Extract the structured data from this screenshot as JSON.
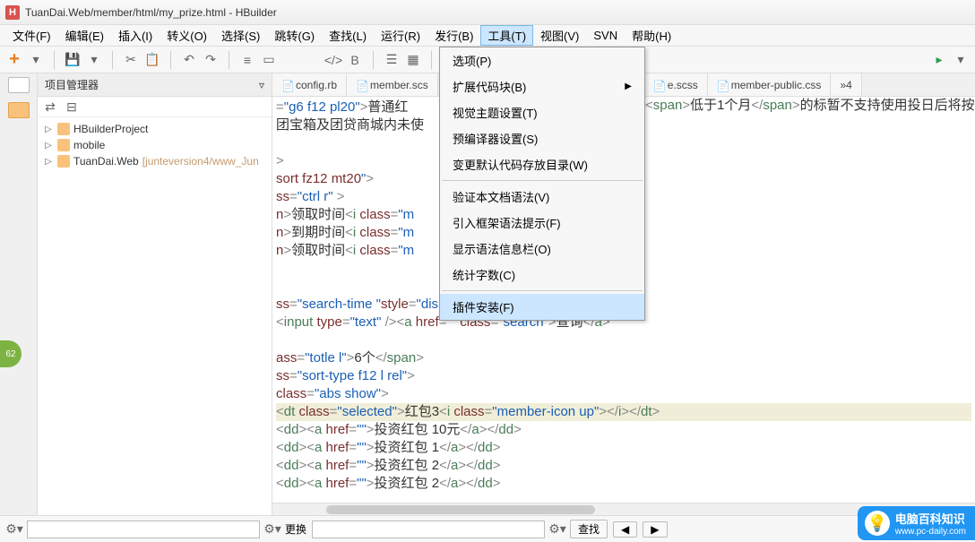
{
  "title": "TuanDai.Web/member/html/my_prize.html  -  HBuilder",
  "title_icon_text": "H",
  "menus": [
    "文件(F)",
    "编辑(E)",
    "插入(I)",
    "转义(O)",
    "选择(S)",
    "跳转(G)",
    "查找(L)",
    "运行(R)",
    "发行(B)",
    "工具(T)",
    "视图(V)",
    "SVN",
    "帮助(H)"
  ],
  "active_menu_index": 9,
  "dropdown": {
    "items": [
      {
        "label": "选项(P)",
        "sub": false
      },
      {
        "label": "扩展代码块(B)",
        "sub": true
      },
      {
        "label": "视觉主题设置(T)",
        "sub": false
      },
      {
        "label": "预编译器设置(S)",
        "sub": false
      },
      {
        "label": "变更默认代码存放目录(W)",
        "sub": false
      }
    ],
    "items2": [
      {
        "label": "验证本文档语法(V)"
      },
      {
        "label": "引入框架语法提示(F)"
      },
      {
        "label": "显示语法信息栏(O)"
      },
      {
        "label": "统计字数(C)"
      }
    ],
    "items3": [
      {
        "label": "插件安装(F)"
      }
    ]
  },
  "panel": {
    "title": "项目管理器",
    "tree": [
      {
        "label": "HBuilderProject",
        "icon": "folder"
      },
      {
        "label": "mobile",
        "icon": "folder"
      },
      {
        "label": "TuanDai.Web",
        "branch": "[junteversion4/www_Jun",
        "icon": "folder"
      }
    ]
  },
  "tabs": [
    "config.rb",
    "member.scs",
    "e.scss",
    "member-public.css"
  ],
  "tabs_extra": "»4",
  "code_lines": [
    {
      "html": "<span class='s-punc'>=</span><span class='s-val'>\"g6 f12 pl20\"</span><span class='s-punc'>&gt;</span><span class='s-txt'>普通红</span>"
    },
    {
      "html": "<span class='s-txt'>团宝箱及团贷商城内未使</span>"
    },
    {
      "html": ""
    },
    {
      "html": "<span class='s-punc'>&gt;</span>"
    },
    {
      "html": "<span class='s-attr'>sort fz12 mt20</span><span class='s-val'>\"</span><span class='s-punc'>&gt;</span>"
    },
    {
      "html": "<span class='s-attr'>ss</span><span class='s-punc'>=</span><span class='s-val'>\"ctrl r\"</span> <span class='s-punc'>&gt;</span>"
    },
    {
      "html": "<span class='s-attr'>n</span><span class='s-punc'>&gt;</span><span class='s-txt'>领取时间</span><span class='s-punc'>&lt;</span><span class='s-tag'>i</span> <span class='s-attr'>class</span><span class='s-punc'>=</span><span class='s-val'>\"m</span>"
    },
    {
      "html": "<span class='s-attr'>n</span><span class='s-punc'>&gt;</span><span class='s-txt'>到期时间</span><span class='s-punc'>&lt;</span><span class='s-tag'>i</span> <span class='s-attr'>class</span><span class='s-punc'>=</span><span class='s-val'>\"m</span>"
    },
    {
      "html": "<span class='s-attr'>n</span><span class='s-punc'>&gt;</span><span class='s-txt'>领取时间</span><span class='s-punc'>&lt;</span><span class='s-tag'>i</span> <span class='s-attr'>class</span><span class='s-punc'>=</span><span class='s-val'>\"m</span>"
    },
    {
      "html": ""
    },
    {
      "html": ""
    },
    {
      "html": "<span class='s-attr'>ss</span><span class='s-punc'>=</span><span class='s-val'>\"search-time \"</span><span class='s-attr'>style</span><span class='s-punc'>=</span><span class='s-val'>\"display:none ;\"</span><span class='s-punc'>&gt;</span>"
    },
    {
      "html": "<span class='s-punc'>&lt;</span><span class='s-tag'>input</span> <span class='s-attr'>type</span><span class='s-punc'>=</span><span class='s-val'>\"text\"</span> <span class='s-punc'>/&gt;&lt;</span><span class='s-tag'>a</span> <span class='s-attr'>href</span><span class='s-punc'>=</span><span class='s-val'>\"\"</span> <span class='s-attr'>class</span><span class='s-punc'>=</span><span class='s-val'>\"search\"</span><span class='s-punc'>&gt;</span><span class='s-txt'>查询</span><span class='s-punc'>&lt;/</span><span class='s-tag'>a</span><span class='s-punc'>&gt;</span>"
    },
    {
      "html": ""
    },
    {
      "html": "<span class='s-attr'>ass</span><span class='s-punc'>=</span><span class='s-val'>\"totle l\"</span><span class='s-punc'>&gt;</span><span class='s-txt'>6个</span><span class='s-punc'>&lt;/</span><span class='s-tag'>span</span><span class='s-punc'>&gt;</span>"
    },
    {
      "html": "<span class='s-attr'>ss</span><span class='s-punc'>=</span><span class='s-val'>\"sort-type f12 l rel\"</span><span class='s-punc'>&gt;</span>"
    },
    {
      "html": "<span class='s-attr'>class</span><span class='s-punc'>=</span><span class='s-val'>\"abs show\"</span><span class='s-punc'>&gt;</span>"
    },
    {
      "html": "<span class='s-punc'>&lt;</span><span class='s-tag'>dt</span> <span class='s-attr'>class</span><span class='s-punc'>=</span><span class='s-val'>\"selected\"</span><span class='s-punc'>&gt;</span><span class='s-txt'>红包3</span><span class='s-punc'>&lt;</span><span class='s-tag'>i</span> <span class='s-attr'>class</span><span class='s-punc'>=</span><span class='s-val'>\"member-icon up\"</span><span class='s-punc'>&gt;&lt;/</span><span class='s-tag'>i</span><span class='s-punc'>&gt;&lt;/</span><span class='s-tag'>dt</span><span class='s-punc'>&gt;</span>",
      "hl": true
    },
    {
      "html": "<span class='s-punc'>&lt;</span><span class='s-tag'>dd</span><span class='s-punc'>&gt;&lt;</span><span class='s-tag'>a</span> <span class='s-attr'>href</span><span class='s-punc'>=</span><span class='s-val'>\"\"</span><span class='s-punc'>&gt;</span><span class='s-txt'>投资红包 10元</span><span class='s-punc'>&lt;/</span><span class='s-tag'>a</span><span class='s-punc'>&gt;&lt;/</span><span class='s-tag'>dd</span><span class='s-punc'>&gt;</span>"
    },
    {
      "html": "<span class='s-punc'>&lt;</span><span class='s-tag'>dd</span><span class='s-punc'>&gt;&lt;</span><span class='s-tag'>a</span> <span class='s-attr'>href</span><span class='s-punc'>=</span><span class='s-val'>\"\"</span><span class='s-punc'>&gt;</span><span class='s-txt'>投资红包 1</span><span class='s-punc'>&lt;/</span><span class='s-tag'>a</span><span class='s-punc'>&gt;&lt;/</span><span class='s-tag'>dd</span><span class='s-punc'>&gt;</span>"
    },
    {
      "html": "<span class='s-punc'>&lt;</span><span class='s-tag'>dd</span><span class='s-punc'>&gt;&lt;</span><span class='s-tag'>a</span> <span class='s-attr'>href</span><span class='s-punc'>=</span><span class='s-val'>\"\"</span><span class='s-punc'>&gt;</span><span class='s-txt'>投资红包 2</span><span class='s-punc'>&lt;/</span><span class='s-tag'>a</span><span class='s-punc'>&gt;&lt;/</span><span class='s-tag'>dd</span><span class='s-punc'>&gt;</span>"
    },
    {
      "html": "<span class='s-punc'>&lt;</span><span class='s-tag'>dd</span><span class='s-punc'>&gt;&lt;</span><span class='s-tag'>a</span> <span class='s-attr'>href</span><span class='s-punc'>=</span><span class='s-val'>\"\"</span><span class='s-punc'>&gt;</span><span class='s-txt'>投资红包 2</span><span class='s-punc'>&lt;/</span><span class='s-tag'>a</span><span class='s-punc'>&gt;&lt;/</span><span class='s-tag'>dd</span><span class='s-punc'>&gt;</span>"
    }
  ],
  "code_right": [
    {
      "html": "<span class='s-punc'>&lt;</span><span class='s-tag'>span</span><span class='s-punc'>&gt;</span><span class='s-txt'>低于1个月</span><span class='s-punc'>&lt;/</span><span class='s-tag'>span</span><span class='s-punc'>&gt;</span><span class='s-txt'>的标暂不支持使用投</span>"
    },
    {
      "html": "<span class='s-txt'>日后将按放弃申领作失效处理。</span><span class='s-punc'>&lt;/</span><span class='s-tag'>span</span><span class='s-punc'>&gt;&lt;/</span><span class='s-tag'>p</span><span class='s-punc'>&gt;</span>"
    },
    {
      "html": ""
    },
    {
      "html": ""
    },
    {
      "html": ""
    },
    {
      "html": ""
    },
    {
      "html": "<span class='s-punc'>&gt;&lt;/</span><span class='s-tag'>span</span><span class='s-punc'>&gt;</span>"
    },
    {
      "html": "<span class='s-punc'>&gt;&lt;/</span><span class='s-tag'>span</span><span class='s-punc'>&gt;</span>"
    },
    {
      "html": "<span class='s-punc'>&gt;&lt;/</span><span class='s-tag'>span</span><span class='s-punc'>&gt;</span>"
    }
  ],
  "footer": {
    "replace": "更换",
    "find": "查找",
    "btn1": "◀",
    "btn2": "▶"
  },
  "logo": {
    "text1": "电脑百科知识",
    "text2": "www.pc-daily.com"
  },
  "green_badge": "62"
}
